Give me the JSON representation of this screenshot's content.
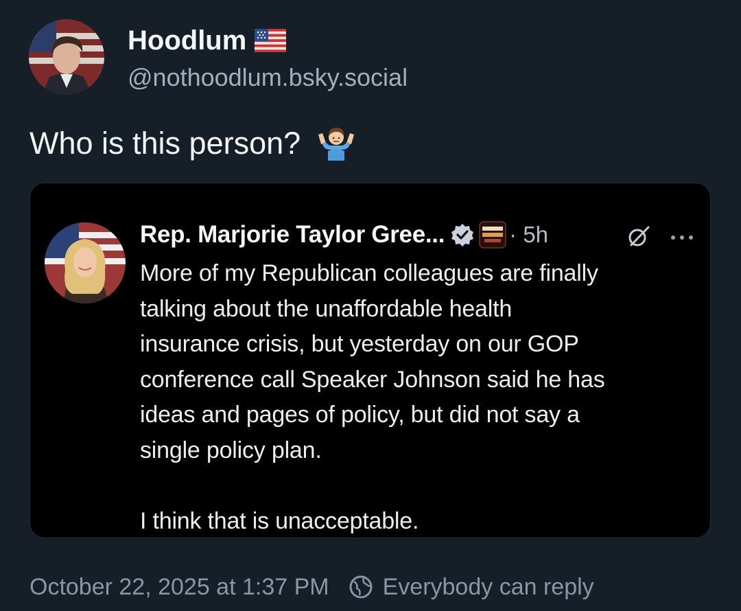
{
  "author": {
    "display_name": "Hoodlum",
    "flag": "us-flag-icon",
    "handle": "@nothoodlum.bsky.social",
    "avatar": "avatar"
  },
  "post": {
    "text": "Who is this person?",
    "emoji": "shrug-icon"
  },
  "quoted": {
    "name": "Rep. Marjorie Taylor Gree...",
    "time": "· 5h",
    "paragraphs": [
      "More of my Republican colleagues are finally\ntalking about the unaffordable health\ninsurance crisis, but yesterday on our GOP\nconference call Speaker Johnson said he has\nideas and pages of policy, but did not say a\nsingle policy plan.",
      "I think that is unacceptable."
    ],
    "icons": [
      "verified-icon",
      "affiliate-badge",
      "grok-icon",
      "more-icon"
    ]
  },
  "footer": {
    "timestamp": "October 22, 2025 at 1:37 PM",
    "reply_setting": "Everybody can reply"
  },
  "colors": {
    "background": "#161e27",
    "embed_background": "#000000",
    "muted_text": "#8896a5",
    "verified_blue": "#c9d3dc"
  }
}
